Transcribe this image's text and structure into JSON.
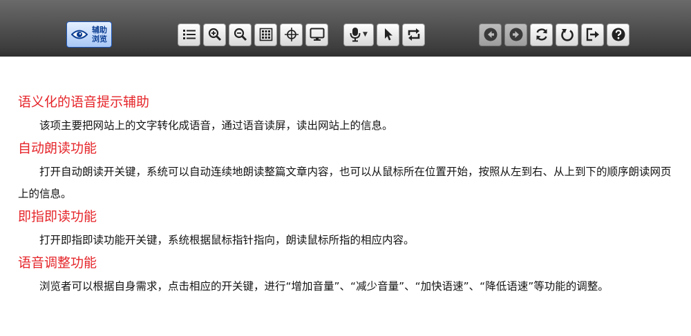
{
  "logo": {
    "line1": "辅助",
    "line2": "浏览"
  },
  "toolbar": {
    "group_a": [
      "list-icon",
      "zoom-in-icon",
      "zoom-out-icon",
      "grid-icon",
      "crosshair-icon",
      "monitor-icon"
    ],
    "group_b": [
      "microphone-icon",
      "pointer-icon",
      "loop-icon"
    ],
    "group_c": [
      "arrow-left-icon",
      "arrow-right-icon",
      "refresh-icon",
      "reset-icon",
      "exit-icon",
      "help-icon"
    ]
  },
  "colors": {
    "heading": "#e5252a",
    "toolbar": "#4a4a4a",
    "logo_bg": "#a8c7f5"
  },
  "sections": [
    {
      "title": "语义化的语音提示辅助",
      "text": "该项主要把网站上的文字转化成语音，通过语音读屏，读出网站上的信息。"
    },
    {
      "title": "自动朗读功能",
      "text": "打开自动朗读开关键，系统可以自动连续地朗读整篇文章内容，也可以从鼠标所在位置开始，按照从左到右、从上到下的顺序朗读网页上的信息。"
    },
    {
      "title": "即指即读功能",
      "text": "打开即指即读功能开关键，系统根据鼠标指针指向，朗读鼠标所指的相应内容。"
    },
    {
      "title": "语音调整功能",
      "text": "浏览者可以根据自身需求，点击相应的开关键，进行“增加音量”、“减少音量”、“加快语速”、“降低语速”等功能的调整。"
    }
  ]
}
